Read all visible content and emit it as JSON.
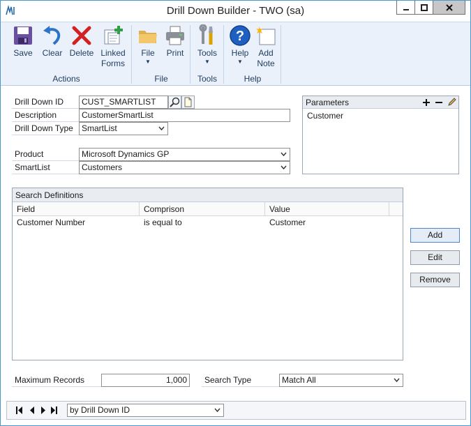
{
  "window": {
    "title": "Drill Down Builder  -  TWO (sa)"
  },
  "ribbon": {
    "actions": {
      "caption": "Actions",
      "save": "Save",
      "clear": "Clear",
      "delete": "Delete",
      "linked_forms_1": "Linked",
      "linked_forms_2": "Forms"
    },
    "file": {
      "caption": "File",
      "file": "File",
      "print": "Print"
    },
    "tools": {
      "caption": "Tools",
      "tools": "Tools"
    },
    "help": {
      "caption": "Help",
      "help": "Help",
      "add_note_1": "Add",
      "add_note_2": "Note"
    }
  },
  "form": {
    "drill_down_id": {
      "label": "Drill Down ID",
      "value": "CUST_SMARTLIST"
    },
    "description": {
      "label": "Description",
      "value": "CustomerSmartList"
    },
    "drill_down_type": {
      "label": "Drill Down Type",
      "value": "SmartList"
    },
    "product": {
      "label": "Product",
      "value": "Microsoft Dynamics GP"
    },
    "smartlist": {
      "label": "SmartList",
      "value": "Customers"
    }
  },
  "parameters": {
    "title": "Parameters",
    "items": [
      "Customer"
    ]
  },
  "search_definitions": {
    "title": "Search Definitions",
    "columns": [
      "Field",
      "Comprison",
      "Value"
    ],
    "rows": [
      {
        "field": "Customer Number",
        "comparison": "is equal to",
        "value": "Customer"
      }
    ],
    "buttons": {
      "add": "Add",
      "edit": "Edit",
      "remove": "Remove"
    }
  },
  "footer_fields": {
    "max_records": {
      "label": "Maximum Records",
      "value": "1,000"
    },
    "search_type": {
      "label": "Search Type",
      "value": "Match All"
    }
  },
  "navigation": {
    "sort_by": "by Drill Down ID"
  },
  "icons": {
    "save": "floppy-disk-icon",
    "clear": "undo-arrow-icon",
    "delete": "red-x-icon",
    "linked_forms": "linked-forms-icon",
    "file": "folder-icon",
    "print": "printer-icon",
    "tools": "tools-icon",
    "help": "help-question-icon",
    "add_note": "note-icon"
  },
  "colors": {
    "ribbon_bg": "#eaf1fb",
    "accent": "#4a97d0",
    "delete_red": "#d32020",
    "help_blue": "#1f5fbf"
  }
}
